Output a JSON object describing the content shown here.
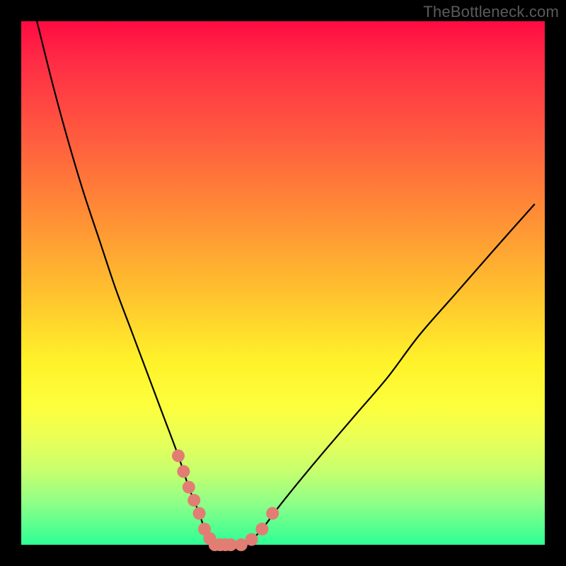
{
  "watermark": "TheBottleneck.com",
  "chart_data": {
    "type": "line",
    "title": "",
    "xlabel": "",
    "ylabel": "",
    "xlim": [
      0,
      100
    ],
    "ylim": [
      0,
      100
    ],
    "grid": false,
    "series": [
      {
        "name": "bottleneck-curve",
        "x": [
          3,
          6,
          9,
          12,
          15,
          18,
          21,
          24,
          27,
          30,
          32,
          34,
          35,
          36,
          37,
          38,
          40,
          42,
          44,
          46,
          49,
          53,
          58,
          64,
          70,
          76,
          83,
          90,
          98
        ],
        "values": [
          100,
          88,
          77,
          67,
          58,
          49,
          41,
          33,
          25,
          17,
          11,
          6,
          3,
          1,
          0,
          0,
          0,
          0,
          1,
          3,
          7,
          12,
          18,
          25,
          32,
          40,
          48,
          56,
          65
        ]
      }
    ],
    "markers": {
      "name": "highlight-dots",
      "x": [
        30,
        31,
        32,
        33,
        34,
        35,
        36,
        37,
        38,
        39,
        40,
        42,
        44,
        46,
        48
      ],
      "values": [
        17,
        14,
        11,
        8.5,
        6,
        3,
        1.2,
        0,
        0,
        0,
        0,
        0,
        1,
        3,
        6
      ]
    },
    "colors": {
      "gradient_top": "#ff0b42",
      "gradient_mid": "#fff22a",
      "gradient_bottom": "#2eff94",
      "curve": "#000000",
      "markers": "#e27d73"
    }
  }
}
